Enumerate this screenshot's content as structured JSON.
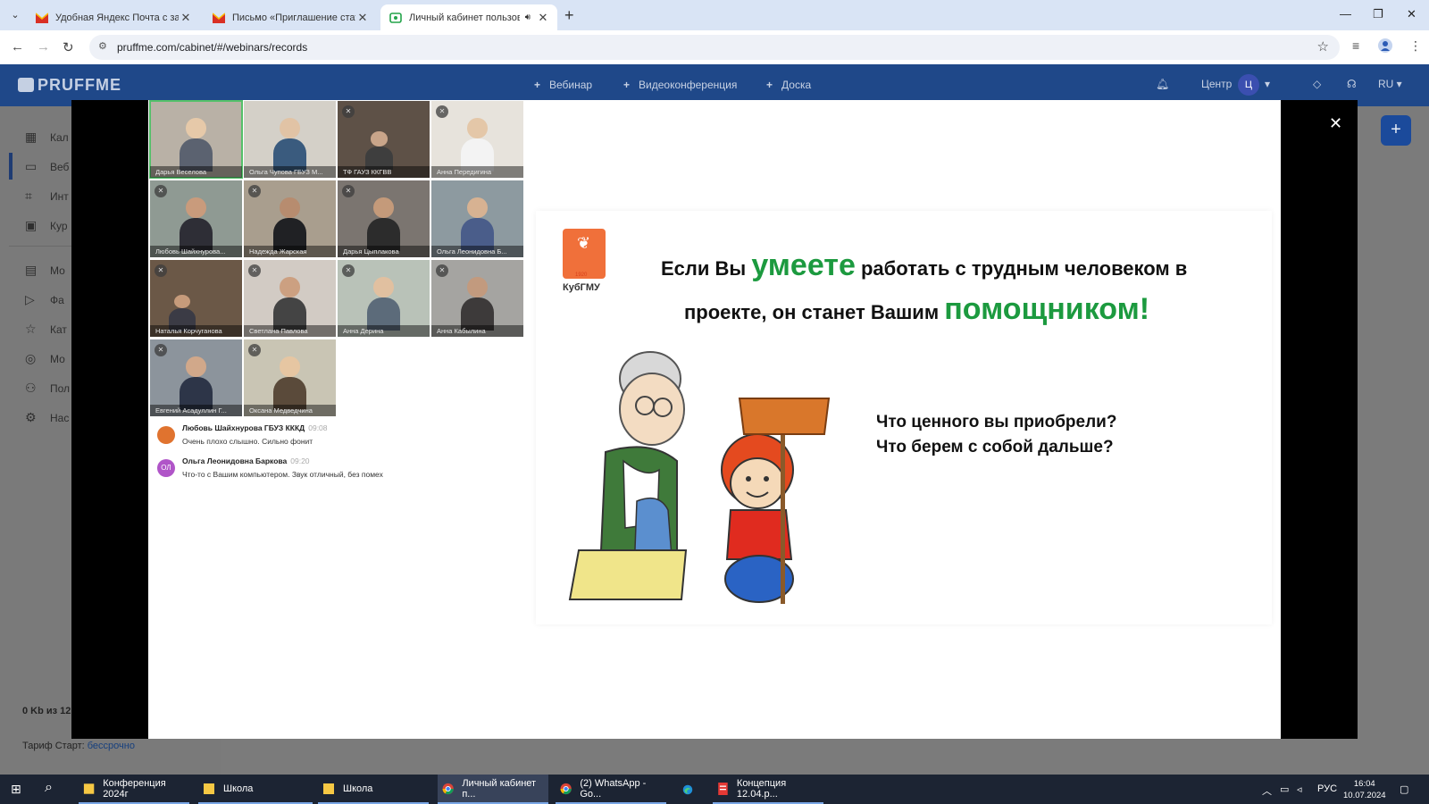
{
  "browser": {
    "tabs": [
      {
        "label": "Удобная Яндекс Почта с защи",
        "icon": "gmail-icon",
        "active": false
      },
      {
        "label": "Письмо «Приглашение стать",
        "icon": "gmail-icon",
        "active": false
      },
      {
        "label": "Личный кабинет пользова",
        "icon": "pruffme-icon",
        "active": true
      }
    ],
    "url": "pruffme.com/cabinet/#/webinars/records"
  },
  "app": {
    "logo": "PRUFFME",
    "nav": [
      {
        "label": "Вебинар"
      },
      {
        "label": "Видеоконференция"
      },
      {
        "label": "Доска"
      }
    ],
    "center_label": "Центр",
    "avatar_letter": "Ц",
    "language": "RU"
  },
  "sidebar": {
    "items": [
      {
        "label": "Кал",
        "icon": "calendar-icon"
      },
      {
        "label": "Веб",
        "icon": "video-icon"
      },
      {
        "label": "Инт",
        "icon": "frame-icon"
      },
      {
        "label": "Кур",
        "icon": "briefcase-icon"
      },
      {
        "label": "Мо",
        "icon": "chat-icon"
      },
      {
        "label": "Фа",
        "icon": "play-icon"
      },
      {
        "label": "Кат",
        "icon": "star-icon"
      },
      {
        "label": "Мо",
        "icon": "database-icon"
      },
      {
        "label": "Пол",
        "icon": "users-icon"
      },
      {
        "label": "Нас",
        "icon": "gear-icon"
      }
    ],
    "storage": "0 Kb из 12",
    "tariff_label": "Тариф Старт:",
    "tariff_value": "бессрочно"
  },
  "participants": [
    {
      "name": "Дарья Веселова",
      "muted": false
    },
    {
      "name": "Ольга Чупова ГБУЗ М...",
      "muted": false
    },
    {
      "name": "ТФ ГАУЗ ККГВВ",
      "muted": true
    },
    {
      "name": "Анна Передигина",
      "muted": true
    },
    {
      "name": "Любовь Шайхнурова...",
      "muted": true
    },
    {
      "name": "Надежда Жарская",
      "muted": true
    },
    {
      "name": "Дарья Цыплакова",
      "muted": true
    },
    {
      "name": "Ольга Леонидовна Б...",
      "muted": false
    },
    {
      "name": "Наталья Корчуганова",
      "muted": true
    },
    {
      "name": "Светлана Павлова",
      "muted": true
    },
    {
      "name": "Анна Дерина",
      "muted": true
    },
    {
      "name": "Анна Кабылина",
      "muted": true
    },
    {
      "name": "Евгений Асадуллин Г...",
      "muted": true
    },
    {
      "name": "Оксана Медведчина",
      "muted": true
    }
  ],
  "chat": [
    {
      "initials": "",
      "author": "Любовь Шайхнурова ГБУЗ КККД",
      "time": "09:08",
      "text": "Очень плохо слышно. Сильно фонит",
      "color": "#e0732f"
    },
    {
      "initials": "ОЛ",
      "author": "Ольга Леонидовна Баркова",
      "time": "09:20",
      "text": "Что-то с Вашим компьютером. Звук отличный, без помех",
      "color": "#b055c8"
    }
  ],
  "slide": {
    "logo_year": "1920",
    "logo_name": "КубГМУ",
    "line1_a": "Если Вы ",
    "line1_green": "умеете",
    "line1_b": " работать с трудным человеком в",
    "line2_a": "проекте, он станет Вашим ",
    "line2_green": "помощником!",
    "question1": "Что ценного вы приобрели?",
    "question2": "Что берем с собой дальше?"
  },
  "taskbar": {
    "apps": [
      {
        "label": "Конференция 2024г",
        "icon": "folder-icon"
      },
      {
        "label": "Школа",
        "icon": "folder-icon"
      },
      {
        "label": "Школа",
        "icon": "folder-icon"
      },
      {
        "label": "Личный кабинет п...",
        "icon": "chrome-icon"
      },
      {
        "label": "(2) WhatsApp - Go...",
        "icon": "chrome-icon"
      },
      {
        "label": "",
        "icon": "edge-icon"
      },
      {
        "label": "Концепция 12.04.p...",
        "icon": "pdf-icon"
      }
    ],
    "lang": "РУС",
    "time": "16:04",
    "date": "10.07.2024"
  },
  "colors": {
    "header": "#1f4889",
    "accent_green": "#1c9a3f",
    "selected_tile": "#54c06a"
  }
}
